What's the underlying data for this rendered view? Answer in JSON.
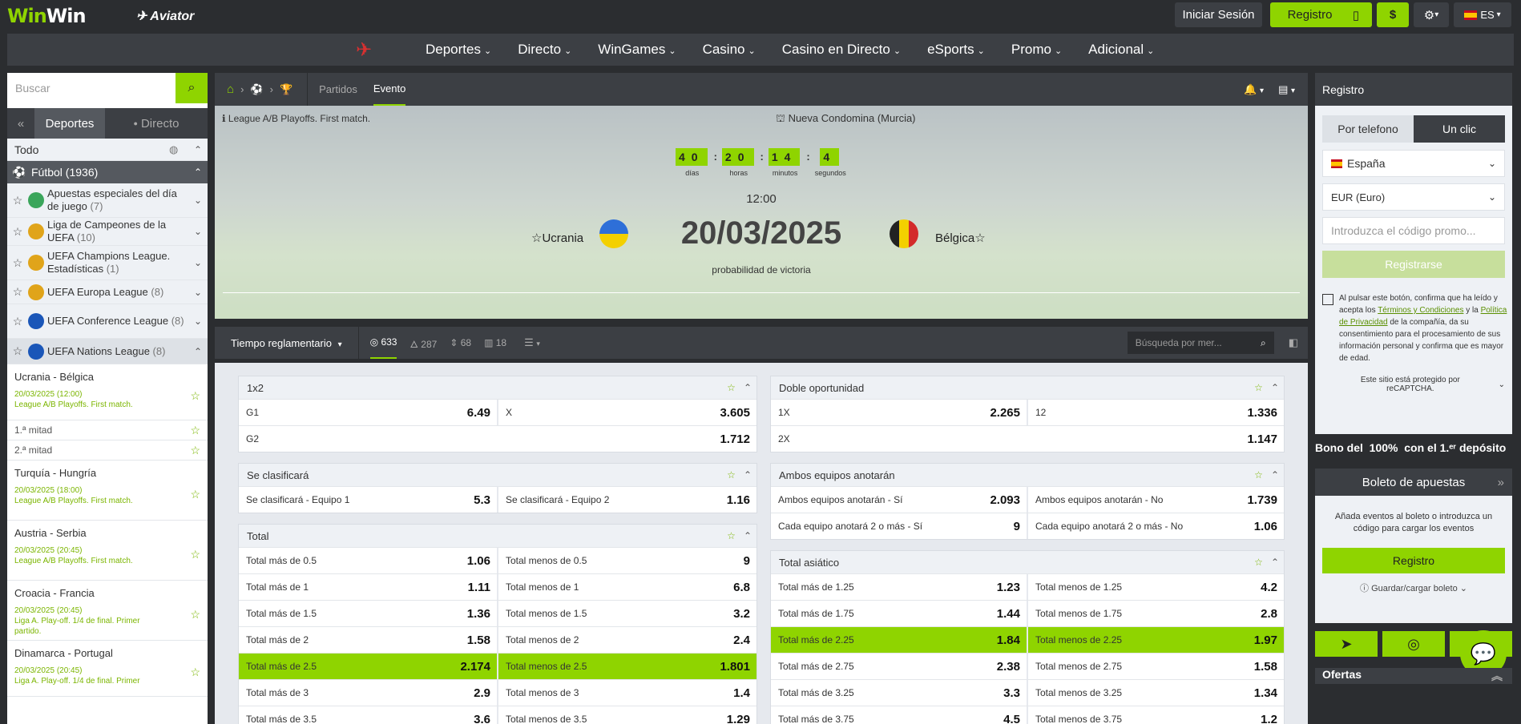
{
  "brand": {
    "logo_a": "Win",
    "logo_b": "Win",
    "aviator": "Aviator"
  },
  "topbar": {
    "login": "Iniciar Sesión",
    "register": "Registro",
    "mobile_icon": "mobile-icon",
    "dollar": "$",
    "lang": "ES"
  },
  "nav": [
    "Deportes",
    "Directo",
    "WinGames",
    "Casino",
    "Casino en Directo",
    "eSports",
    "Promo",
    "Adicional"
  ],
  "left": {
    "search_placeholder": "Buscar",
    "tab_sports": "Deportes",
    "tab_live": "Directo",
    "all": "Todo",
    "football": "Fútbol (1936)",
    "leagues": [
      {
        "name": "Apuestas especiales del día de juego",
        "count": "(7)"
      },
      {
        "name": "Liga de Campeones de la UEFA",
        "count": "(10)"
      },
      {
        "name": "UEFA Champions League. Estadísticas",
        "count": "(1)"
      },
      {
        "name": "UEFA Europa League",
        "count": "(8)"
      },
      {
        "name": "UEFA Conference League",
        "count": "(8)"
      },
      {
        "name": "UEFA Nations League",
        "count": "(8)"
      }
    ],
    "matches": [
      {
        "teams": "Ucrania - Bélgica",
        "info": "20/03/2025 (12:00)\nLeague A/B Playoffs. First match."
      },
      {
        "teams": "1.ª mitad",
        "info": ""
      },
      {
        "teams": "2.ª mitad",
        "info": ""
      },
      {
        "teams": "Turquía - Hungría",
        "info": "20/03/2025 (18:00)\nLeague A/B Playoffs. First match."
      },
      {
        "teams": "Austria - Serbia",
        "info": "20/03/2025 (20:45)\nLeague A/B Playoffs. First match."
      },
      {
        "teams": "Croacia - Francia",
        "info": "20/03/2025 (20:45)\nLiga A. Play-off. 1/4 de final. Primer partido."
      },
      {
        "teams": "Dinamarca - Portugal",
        "info": "20/03/2025 (20:45)\nLiga A. Play-off. 1/4 de final. Primer"
      }
    ]
  },
  "event": {
    "tab_matches": "Partidos",
    "tab_event": "Evento",
    "league": "League A/B Playoffs. First match.",
    "venue": "Nueva Condomina (Murcia)",
    "countdown": [
      {
        "v": "40",
        "l": "días"
      },
      {
        "v": "20",
        "l": "horas"
      },
      {
        "v": "14",
        "l": "minutos"
      },
      {
        "v": "4",
        "l": "segundos"
      }
    ],
    "time": "12:00",
    "date": "20/03/2025",
    "home": "Ucrania",
    "away": "Bélgica",
    "prob": "probabilidad de victoria"
  },
  "filter": {
    "period": "Tiempo reglamentario",
    "c1": "633",
    "c2": "287",
    "c3": "68",
    "c4": "18",
    "search": "Búsqueda por mer..."
  },
  "markets_left": [
    {
      "title": "1x2",
      "rows": [
        [
          {
            "l": "G1",
            "o": "6.49"
          },
          {
            "l": "X",
            "o": "3.605"
          }
        ],
        [
          {
            "l": "G2",
            "o": "1.712"
          }
        ]
      ]
    },
    {
      "title": "Se clasificará",
      "rows": [
        [
          {
            "l": "Se clasificará - Equipo 1",
            "o": "5.3"
          },
          {
            "l": "Se clasificará - Equipo 2",
            "o": "1.16"
          }
        ]
      ]
    },
    {
      "title": "Total",
      "rows": [
        [
          {
            "l": "Total más de 0.5",
            "o": "1.06"
          },
          {
            "l": "Total menos de 0.5",
            "o": "9"
          }
        ],
        [
          {
            "l": "Total más de 1",
            "o": "1.11"
          },
          {
            "l": "Total menos de 1",
            "o": "6.8"
          }
        ],
        [
          {
            "l": "Total más de 1.5",
            "o": "1.36"
          },
          {
            "l": "Total menos de 1.5",
            "o": "3.2"
          }
        ],
        [
          {
            "l": "Total más de 2",
            "o": "1.58"
          },
          {
            "l": "Total menos de 2",
            "o": "2.4"
          }
        ],
        [
          {
            "l": "Total más de 2.5",
            "o": "2.174",
            "h": true
          },
          {
            "l": "Total menos de 2.5",
            "o": "1.801",
            "h": true
          }
        ],
        [
          {
            "l": "Total más de 3",
            "o": "2.9"
          },
          {
            "l": "Total menos de 3",
            "o": "1.4"
          }
        ],
        [
          {
            "l": "Total más de 3.5",
            "o": "3.6"
          },
          {
            "l": "Total menos de 3.5",
            "o": "1.29"
          }
        ]
      ]
    }
  ],
  "markets_right": [
    {
      "title": "Doble oportunidad",
      "rows": [
        [
          {
            "l": "1X",
            "o": "2.265"
          },
          {
            "l": "12",
            "o": "1.336"
          }
        ],
        [
          {
            "l": "2X",
            "o": "1.147"
          }
        ]
      ]
    },
    {
      "title": "Ambos equipos anotarán",
      "rows": [
        [
          {
            "l": "Ambos equipos anotarán - Sí",
            "o": "2.093"
          },
          {
            "l": "Ambos equipos anotarán - No",
            "o": "1.739"
          }
        ],
        [
          {
            "l": "Cada equipo anotará 2 o más - Sí",
            "o": "9"
          },
          {
            "l": "Cada equipo anotará 2 o más - No",
            "o": "1.06"
          }
        ]
      ]
    },
    {
      "title": "Total asiático",
      "rows": [
        [
          {
            "l": "Total más de 1.25",
            "o": "1.23"
          },
          {
            "l": "Total menos de 1.25",
            "o": "4.2"
          }
        ],
        [
          {
            "l": "Total más de 1.75",
            "o": "1.44"
          },
          {
            "l": "Total menos de 1.75",
            "o": "2.8"
          }
        ],
        [
          {
            "l": "Total más de 2.25",
            "o": "1.84",
            "h": true
          },
          {
            "l": "Total menos de 2.25",
            "o": "1.97",
            "h": true
          }
        ],
        [
          {
            "l": "Total más de 2.75",
            "o": "2.38"
          },
          {
            "l": "Total menos de 2.75",
            "o": "1.58"
          }
        ],
        [
          {
            "l": "Total más de 3.25",
            "o": "3.3"
          },
          {
            "l": "Total menos de 3.25",
            "o": "1.34"
          }
        ],
        [
          {
            "l": "Total más de 3.75",
            "o": "4.5"
          },
          {
            "l": "Total menos de 3.75",
            "o": "1.2"
          }
        ]
      ]
    }
  ],
  "right": {
    "title": "Registro",
    "tab_phone": "Por telefono",
    "tab_click": "Un clic",
    "country": "España",
    "currency": "EUR (Euro)",
    "promo_placeholder": "Introduzca el código promo...",
    "register_btn": "Registrarse",
    "terms_a": "Al pulsar este botón, confirma que ha leído y acepta los ",
    "terms_link1": "Términos y Condiciones",
    "terms_b": " y la ",
    "terms_link2": "Política de Privacidad",
    "terms_c": " de la compañía, da su consentimiento para el procesamiento de sus información personal y confirma que es mayor de edad.",
    "recaptcha": "Este sitio está protegido por reCAPTCHA.",
    "bonus": "Bono del  100%  con el 1.ᵉʳ depósito",
    "betslip": "Boleto de apuestas",
    "betslip_empty": "Añada eventos al boleto o introduzca un código para cargar los eventos",
    "betslip_btn": "Registro",
    "save": "Guardar/cargar boleto",
    "offers": "Ofertas"
  }
}
